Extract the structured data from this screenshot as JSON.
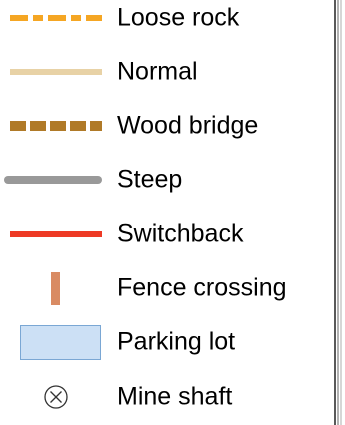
{
  "legend": {
    "items": [
      {
        "label": "Loose rock",
        "icon": "loose-rock-line",
        "color": "#f5a623",
        "color_light": "#f9c98a"
      },
      {
        "label": "Normal",
        "icon": "normal-line",
        "color": "#e8d2a6"
      },
      {
        "label": "Wood bridge",
        "icon": "wood-bridge-line",
        "color": "#b07a28"
      },
      {
        "label": "Steep",
        "icon": "steep-line",
        "color": "#999999"
      },
      {
        "label": "Switchback",
        "icon": "switchback-line",
        "color": "#ee3a25"
      },
      {
        "label": "Fence crossing",
        "icon": "fence-crossing-marker",
        "color": "#d98b63"
      },
      {
        "label": "Parking lot",
        "icon": "parking-lot-area",
        "color": "#cce0f5",
        "border": "#7aa7d4"
      },
      {
        "label": "Mine shaft",
        "icon": "mine-shaft-icon",
        "color": "#333333"
      }
    ]
  },
  "map_edge_color": "#222222"
}
